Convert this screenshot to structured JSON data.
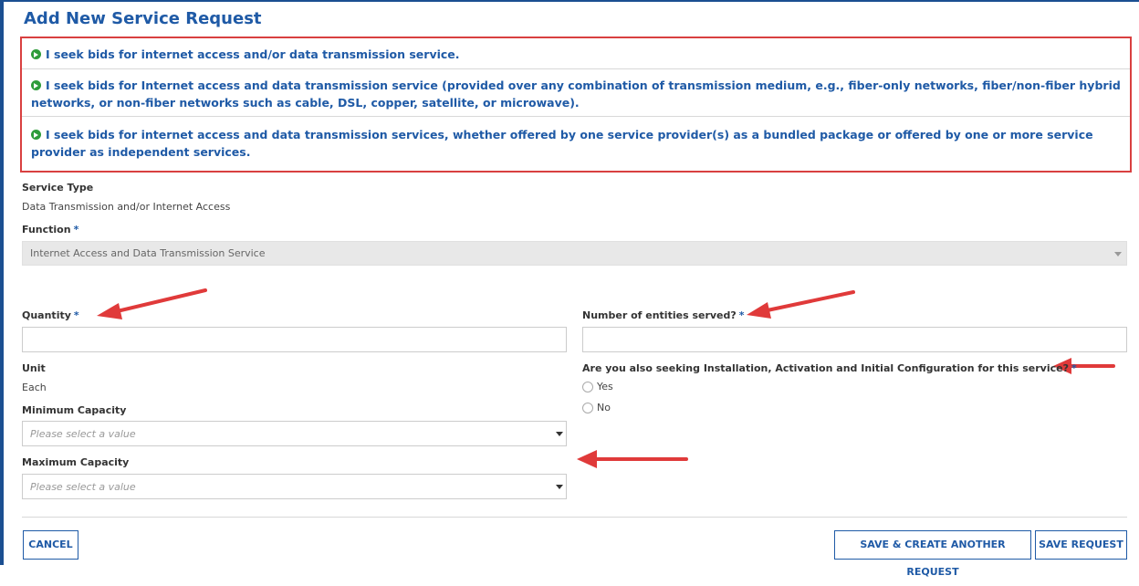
{
  "page": {
    "title": "Add New Service Request"
  },
  "options": [
    "I seek bids for internet access and/or data transmission service.",
    "I seek bids for Internet access and data transmission service (provided over any combination of transmission medium, e.g., fiber-only networks, fiber/non-fiber hybrid networks, or non-fiber networks such as cable, DSL, copper, satellite, or microwave).",
    "I seek bids for internet access and data transmission services, whether offered by one service provider(s) as a bundled package or offered by one or more service provider as independent services."
  ],
  "form": {
    "service_type_label": "Service Type",
    "service_type_value": "Data Transmission and/or Internet Access",
    "function_label": "Function",
    "function_value": "Internet Access and Data Transmission Service",
    "required_marker": "*",
    "quantity_label": "Quantity",
    "quantity_value": "",
    "entities_label": "Number of entities served?",
    "entities_value": "",
    "unit_label": "Unit",
    "unit_value": "Each",
    "min_capacity_label": "Minimum Capacity",
    "min_capacity_placeholder": "Please select a value",
    "max_capacity_label": "Maximum Capacity",
    "max_capacity_placeholder": "Please select a value",
    "installation_question": "Are you also seeking Installation, Activation and Initial Configuration for this service?",
    "radio_yes": "Yes",
    "radio_no": "No"
  },
  "buttons": {
    "cancel": "CANCEL",
    "save_and_create": "SAVE & CREATE ANOTHER REQUEST",
    "save": "SAVE REQUEST"
  },
  "colors": {
    "brand_blue": "#1f5aa6",
    "highlight_red": "#d94040",
    "bullet_green": "#2e9c3a"
  }
}
